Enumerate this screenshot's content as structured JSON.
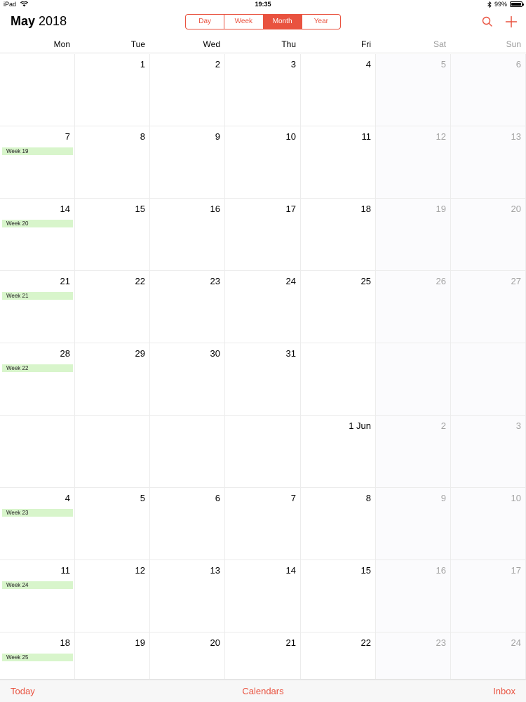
{
  "status_bar": {
    "device": "iPad",
    "time": "19:35",
    "battery": "99%",
    "battery_level": 0.99,
    "icons": [
      "wifi-icon",
      "bluetooth-icon",
      "battery-icon"
    ]
  },
  "header": {
    "month": "May",
    "year": "2018",
    "views": [
      {
        "label": "Day",
        "active": false
      },
      {
        "label": "Week",
        "active": false
      },
      {
        "label": "Month",
        "active": true
      },
      {
        "label": "Year",
        "active": false
      }
    ],
    "icons": [
      "search-icon",
      "plus-icon"
    ]
  },
  "weekdays": [
    "Mon",
    "Tue",
    "Wed",
    "Thu",
    "Fri",
    "Sat",
    "Sun"
  ],
  "weeks": [
    {
      "label": "",
      "days": [
        "",
        "1",
        "2",
        "3",
        "4",
        "5",
        "6"
      ]
    },
    {
      "label": "Week 19",
      "days": [
        "7",
        "8",
        "9",
        "10",
        "11",
        "12",
        "13"
      ]
    },
    {
      "label": "Week 20",
      "days": [
        "14",
        "15",
        "16",
        "17",
        "18",
        "19",
        "20"
      ]
    },
    {
      "label": "Week 21",
      "days": [
        "21",
        "22",
        "23",
        "24",
        "25",
        "26",
        "27"
      ]
    },
    {
      "label": "Week 22",
      "days": [
        "28",
        "29",
        "30",
        "31",
        "",
        "",
        ""
      ]
    },
    {
      "label": "",
      "days": [
        "",
        "",
        "",
        "",
        "1 Jun",
        "2",
        "3"
      ]
    },
    {
      "label": "Week 23",
      "days": [
        "4",
        "5",
        "6",
        "7",
        "8",
        "9",
        "10"
      ]
    },
    {
      "label": "Week 24",
      "days": [
        "11",
        "12",
        "13",
        "14",
        "15",
        "16",
        "17"
      ]
    },
    {
      "label": "Week 25",
      "days": [
        "18",
        "19",
        "20",
        "21",
        "22",
        "23",
        "24"
      ]
    }
  ],
  "tabbar": {
    "today": "Today",
    "calendars": "Calendars",
    "inbox": "Inbox"
  },
  "colors": {
    "accent": "#e9523f",
    "week_label_bg": "#d8f5cb",
    "weekend_text": "#9a9a9a"
  }
}
